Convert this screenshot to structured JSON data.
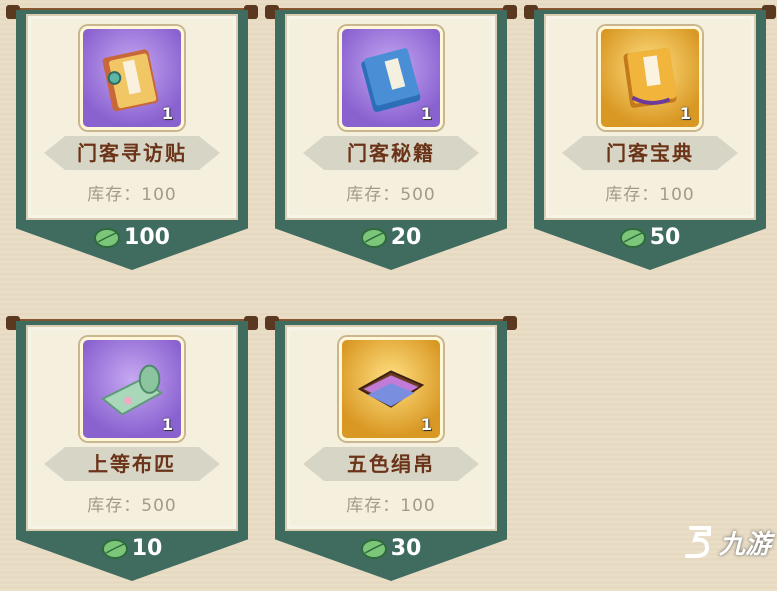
{
  "items": [
    {
      "name": "门客寻访贴",
      "stock": "库存：100",
      "price": "100",
      "qty": "1",
      "bg": "purple",
      "icon": "scroll-book-icon"
    },
    {
      "name": "门客秘籍",
      "stock": "库存：500",
      "price": "20",
      "qty": "1",
      "bg": "purple",
      "icon": "blue-book-icon"
    },
    {
      "name": "门客宝典",
      "stock": "库存：100",
      "price": "50",
      "qty": "1",
      "bg": "gold",
      "icon": "golden-book-icon"
    },
    {
      "name": "上等布匹",
      "stock": "库存：500",
      "price": "10",
      "qty": "1",
      "bg": "purple",
      "icon": "cloth-roll-icon"
    },
    {
      "name": "五色绢帛",
      "stock": "库存：100",
      "price": "30",
      "qty": "1",
      "bg": "gold",
      "icon": "silk-tray-icon"
    }
  ],
  "currency_icon": "green-leaf-icon",
  "watermark": "九游",
  "colors": {
    "banner": "#3f6c5f",
    "name": "#6b3318",
    "stock": "#a59a87",
    "background": "#e9dcc4"
  }
}
